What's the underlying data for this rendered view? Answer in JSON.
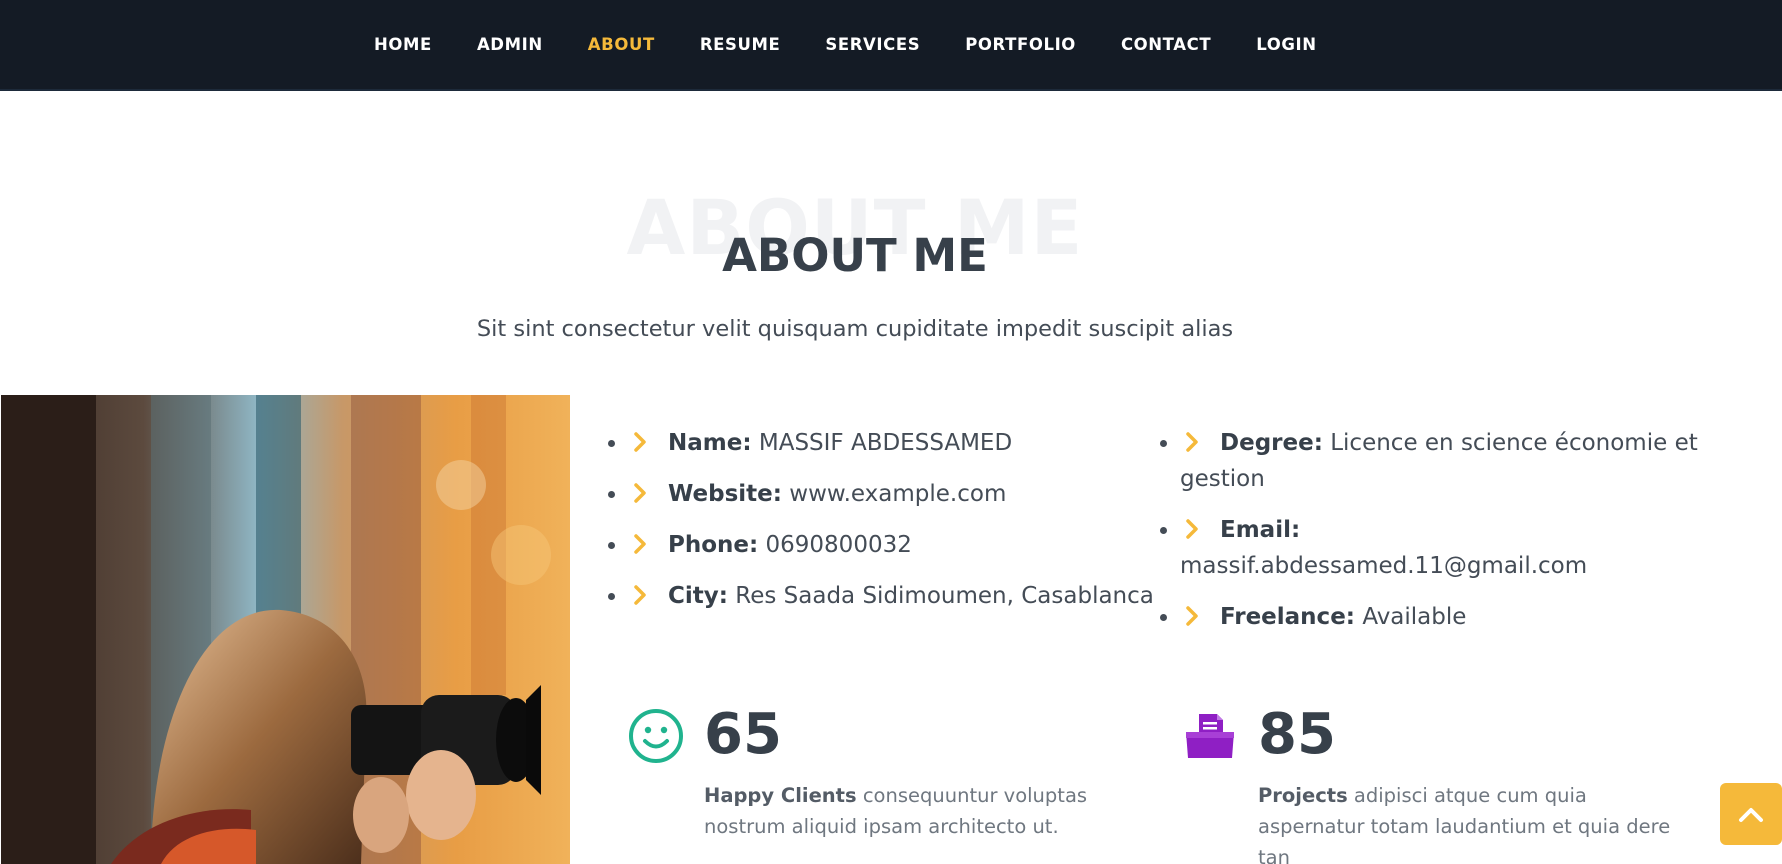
{
  "nav": {
    "items": [
      {
        "label": "HOME",
        "active": false
      },
      {
        "label": "ADMIN",
        "active": false
      },
      {
        "label": "ABOUT",
        "active": true
      },
      {
        "label": "RESUME",
        "active": false
      },
      {
        "label": "SERVICES",
        "active": false
      },
      {
        "label": "PORTFOLIO",
        "active": false
      },
      {
        "label": "CONTACT",
        "active": false
      },
      {
        "label": "LOGIN",
        "active": false
      }
    ]
  },
  "section": {
    "background_title": "ABOUT ME",
    "title": "ABOUT ME",
    "subtitle": "Sit sint consectetur velit quisquam cupiditate impedit suscipit alias"
  },
  "photo": {
    "icon": "photographer-image"
  },
  "info_left": [
    {
      "label": "Name:",
      "value": "MASSIF ABDESSAMED"
    },
    {
      "label": "Website:",
      "value": "www.example.com"
    },
    {
      "label": "Phone:",
      "value": "0690800032"
    },
    {
      "label": "City:",
      "value": "Res Saada Sidimoumen, Casablanca"
    }
  ],
  "info_right": [
    {
      "label": "Degree:",
      "value": "Licence en science économie et gestion"
    },
    {
      "label": "Email:",
      "value": "massif.abdessamed.11@gmail.com"
    },
    {
      "label": "Freelance:",
      "value": "Available"
    }
  ],
  "counts": [
    {
      "icon": "smiley-icon",
      "number": "65",
      "label": "Happy Clients",
      "text": "consequuntur voluptas nostrum aliquid ipsam architecto ut.",
      "color": "#20b38e"
    },
    {
      "icon": "inbox-icon",
      "number": "85",
      "label": "Projects",
      "text": "adipisci atque cum quia aspernatur totam laudantium et quia dere tan",
      "color": "#8f1fc4"
    }
  ],
  "colors": {
    "accent": "#f5b93a",
    "nav_bg": "#141b25",
    "heading": "#37404a"
  },
  "back_to_top": {
    "icon": "chevron-up-icon"
  }
}
